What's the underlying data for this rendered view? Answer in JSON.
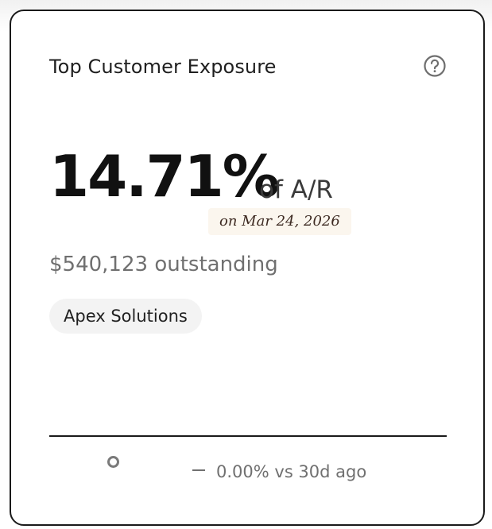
{
  "card": {
    "title": "Top Customer Exposure",
    "help_icon": "question-circle-icon",
    "metric": {
      "value": "14.71%",
      "unit": "of A/R",
      "as_of": "on Mar 24, 2026"
    },
    "outstanding": "$540,123 outstanding",
    "customer": "Apex Solutions",
    "trend": {
      "icon": "dash-icon",
      "text": "0.00% vs 30d ago"
    }
  },
  "colors": {
    "text_primary": "#111111",
    "text_muted": "#707070",
    "chip_bg": "#fbf6ee",
    "pill_bg": "#f3f3f3",
    "border": "#1a1a1a"
  }
}
